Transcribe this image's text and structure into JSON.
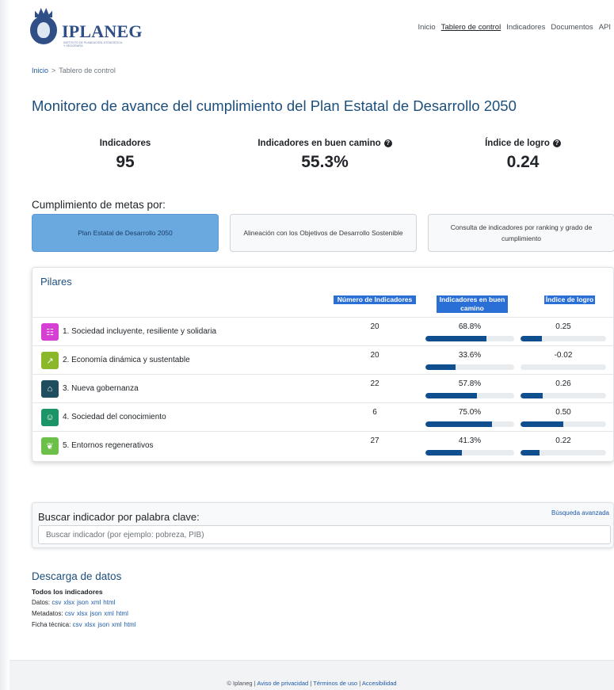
{
  "brand": {
    "name": "IPLANEG",
    "tagline": "INSTITUTO DE PLANEACIÓN, ESTADÍSTICA Y GEOGRAFÍA"
  },
  "nav": {
    "items": [
      "Inicio",
      "Tablero de control",
      "Indicadores",
      "Documentos",
      "API"
    ],
    "active_index": 1
  },
  "breadcrumb": {
    "home": "Inicio",
    "separator": ">",
    "current": "Tablero de control"
  },
  "page": {
    "title": "Monitoreo de avance del cumplimiento del Plan Estatal de Desarrollo 2050"
  },
  "stats": [
    {
      "label": "Indicadores",
      "value": "95",
      "has_help": false
    },
    {
      "label": "Indicadores en buen camino",
      "value": "55.3%",
      "has_help": true
    },
    {
      "label": "Índice de logro",
      "value": "0.24",
      "has_help": true
    }
  ],
  "goals": {
    "label": "Cumplimiento de metas por:",
    "tabs": [
      "Plan Estatal de Desarrollo 2050",
      "Alineación con los Objetivos de Desarrollo Sostenible",
      "Consulta de indicadores por ranking y grado de cumplimiento"
    ],
    "active_index": 0
  },
  "pillars": {
    "title": "Pilares",
    "columns": [
      "Número de Indicadores",
      "Indicadores en buen camino",
      "Índice de logro"
    ],
    "rows": [
      {
        "label": "1. Sociedad incluyente, resiliente y solidaria",
        "count": "20",
        "pct": "68.8%",
        "pct_value": 0.688,
        "index": "0.25",
        "index_value": 0.25,
        "icon": "people-icon",
        "color": "#d63fd3"
      },
      {
        "label": "2. Economía dinámica y sustentable",
        "count": "20",
        "pct": "33.6%",
        "pct_value": 0.336,
        "index": "-0.02",
        "index_value": 0.0,
        "icon": "growth-chart-icon",
        "color": "#8ab82a"
      },
      {
        "label": "3. Nueva gobernanza",
        "count": "22",
        "pct": "57.8%",
        "pct_value": 0.578,
        "index": "0.26",
        "index_value": 0.26,
        "icon": "government-building-icon",
        "color": "#1f4e5f"
      },
      {
        "label": "4. Sociedad del conocimiento",
        "count": "6",
        "pct": "75.0%",
        "pct_value": 0.75,
        "index": "0.50",
        "index_value": 0.5,
        "icon": "head-profile-icon",
        "color": "#1b9467"
      },
      {
        "label": "5. Entornos regenerativos",
        "count": "27",
        "pct": "41.3%",
        "pct_value": 0.413,
        "index": "0.22",
        "index_value": 0.22,
        "icon": "leaf-icon",
        "color": "#6cc04a"
      }
    ]
  },
  "search": {
    "title": "Buscar indicador por palabra clave:",
    "advanced": "Búsqueda avanzada",
    "placeholder": "Buscar indicador (por ejemplo: pobreza, PIB)"
  },
  "downloads": {
    "title": "Descarga de datos",
    "subtitle": "Todos los indicadores",
    "lines": [
      {
        "label": "Datos:",
        "formats": [
          "csv",
          "xlsx",
          "json",
          "xml",
          "html"
        ]
      },
      {
        "label": "Metadatos:",
        "formats": [
          "csv",
          "xlsx",
          "json",
          "xml",
          "html"
        ]
      },
      {
        "label": "Ficha técnica:",
        "formats": [
          "csv",
          "xlsx",
          "json",
          "xml",
          "html"
        ]
      }
    ]
  },
  "footer": {
    "owner": "© Iplaneg",
    "separator": "|",
    "links": [
      "Aviso de privacidad",
      "Términos de uso",
      "Accesibilidad"
    ]
  }
}
